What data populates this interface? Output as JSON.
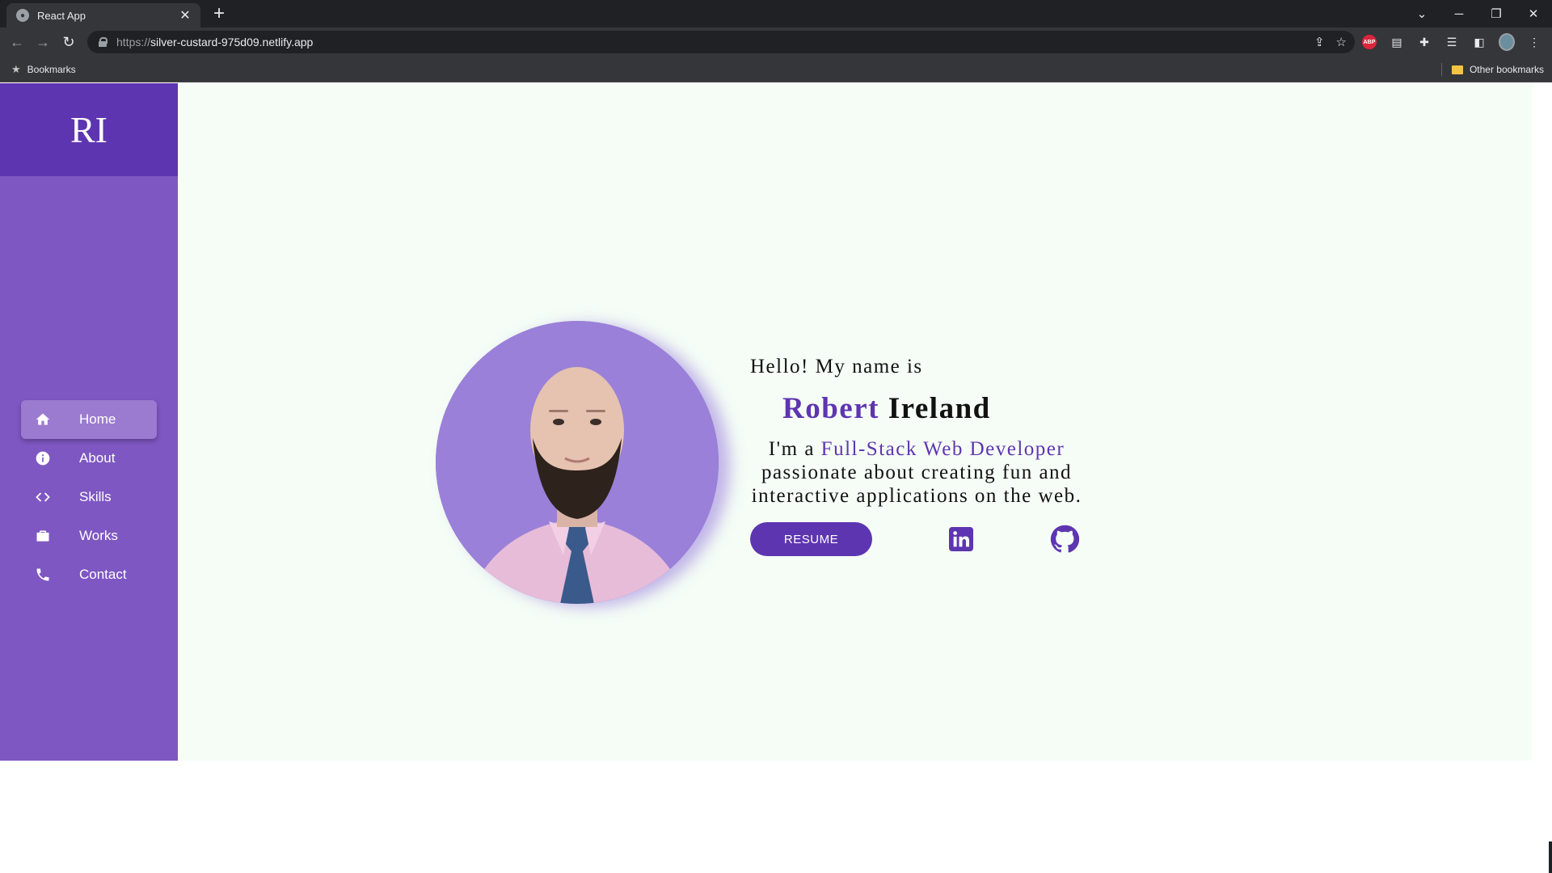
{
  "browser": {
    "tab_title": "React App",
    "tab_close": "✕",
    "new_tab": "+",
    "url_scheme": "https://",
    "url_host": "silver-custard-975d09.netlify.app",
    "bookmarks_label": "Bookmarks",
    "other_bookmarks_label": "Other bookmarks",
    "extension_abp": "ABP"
  },
  "sidebar": {
    "brand": "RI",
    "items": [
      {
        "label": "Home",
        "icon": "home-icon",
        "active": true
      },
      {
        "label": "About",
        "icon": "info-icon",
        "active": false
      },
      {
        "label": "Skills",
        "icon": "code-icon",
        "active": false
      },
      {
        "label": "Works",
        "icon": "briefcase-icon",
        "active": false
      },
      {
        "label": "Contact",
        "icon": "phone-icon",
        "active": false
      }
    ]
  },
  "hero": {
    "greeting": "Hello! My name is",
    "first_name": "Robert",
    "last_name": "Ireland",
    "intro_prefix": "I'm a",
    "role": "Full-Stack Web Developer",
    "intro_suffix": "passionate about creating fun and interactive applications on the web.",
    "resume_label": "RESUME",
    "social": [
      "linkedin-icon",
      "github-icon"
    ]
  },
  "colors": {
    "sidebar": "#7e57c2",
    "brand_bg": "#5e35b1",
    "accent": "#5e35b1",
    "page_bg": "#f5fdf6"
  }
}
